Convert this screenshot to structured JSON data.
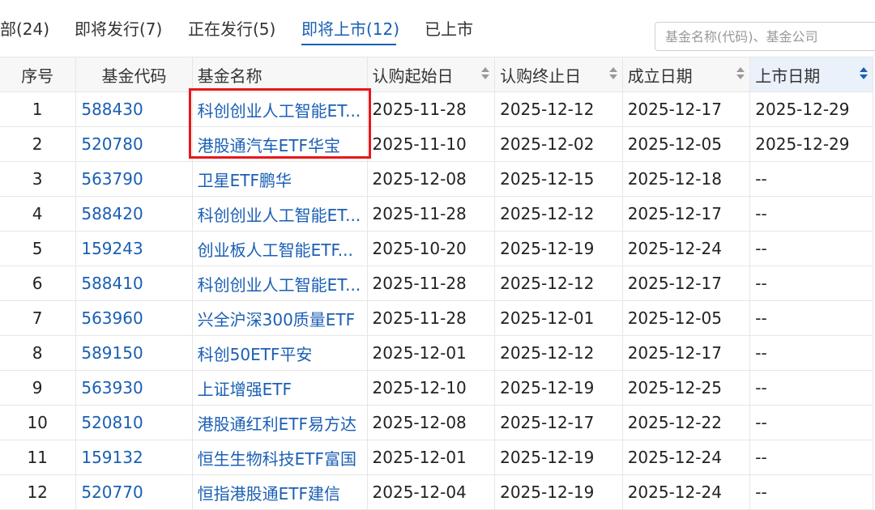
{
  "tabs": [
    {
      "label": "部(24)"
    },
    {
      "label": "即将发行(7)"
    },
    {
      "label": "正在发行(5)"
    },
    {
      "label": "即将上市(12)",
      "active": true
    },
    {
      "label": "已上市"
    }
  ],
  "search": {
    "placeholder": "基金名称(代码)、基金公司"
  },
  "table": {
    "headers": [
      "序号",
      "基金代码",
      "基金名称",
      "认购起始日",
      "认购终止日",
      "成立日期",
      "上市日期"
    ],
    "rows": [
      {
        "idx": "1",
        "code": "588430",
        "name": "科创创业人工智能ET...",
        "start": "2025-11-28",
        "end": "2025-12-12",
        "found": "2025-12-17",
        "list": "2025-12-29"
      },
      {
        "idx": "2",
        "code": "520780",
        "name": "港股通汽车ETF华宝",
        "start": "2025-11-10",
        "end": "2025-12-02",
        "found": "2025-12-05",
        "list": "2025-12-29"
      },
      {
        "idx": "3",
        "code": "563790",
        "name": "卫星ETF鹏华",
        "start": "2025-12-08",
        "end": "2025-12-15",
        "found": "2025-12-18",
        "list": "--"
      },
      {
        "idx": "4",
        "code": "588420",
        "name": "科创创业人工智能ET...",
        "start": "2025-11-28",
        "end": "2025-12-12",
        "found": "2025-12-17",
        "list": "--"
      },
      {
        "idx": "5",
        "code": "159243",
        "name": "创业板人工智能ETF...",
        "start": "2025-10-20",
        "end": "2025-12-19",
        "found": "2025-12-24",
        "list": "--"
      },
      {
        "idx": "6",
        "code": "588410",
        "name": "科创创业人工智能ET...",
        "start": "2025-11-28",
        "end": "2025-12-12",
        "found": "2025-12-17",
        "list": "--"
      },
      {
        "idx": "7",
        "code": "563960",
        "name": "兴全沪深300质量ETF",
        "start": "2025-11-28",
        "end": "2025-12-01",
        "found": "2025-12-05",
        "list": "--"
      },
      {
        "idx": "8",
        "code": "589150",
        "name": "科创50ETF平安",
        "start": "2025-12-01",
        "end": "2025-12-12",
        "found": "2025-12-17",
        "list": "--"
      },
      {
        "idx": "9",
        "code": "563930",
        "name": "上证增强ETF",
        "start": "2025-12-10",
        "end": "2025-12-19",
        "found": "2025-12-25",
        "list": "--"
      },
      {
        "idx": "10",
        "code": "520810",
        "name": "港股通红利ETF易方达",
        "start": "2025-12-08",
        "end": "2025-12-17",
        "found": "2025-12-22",
        "list": "--"
      },
      {
        "idx": "11",
        "code": "159132",
        "name": "恒生生物科技ETF富国",
        "start": "2025-12-01",
        "end": "2025-12-19",
        "found": "2025-12-24",
        "list": "--"
      },
      {
        "idx": "12",
        "code": "520770",
        "name": "恒指港股通ETF建信",
        "start": "2025-12-04",
        "end": "2025-12-19",
        "found": "2025-12-24",
        "list": "--"
      }
    ]
  },
  "colors": {
    "accent": "#1a5fb4",
    "highlight": "#e8171a"
  },
  "icons": {
    "sort": "sort-arrows-icon"
  }
}
